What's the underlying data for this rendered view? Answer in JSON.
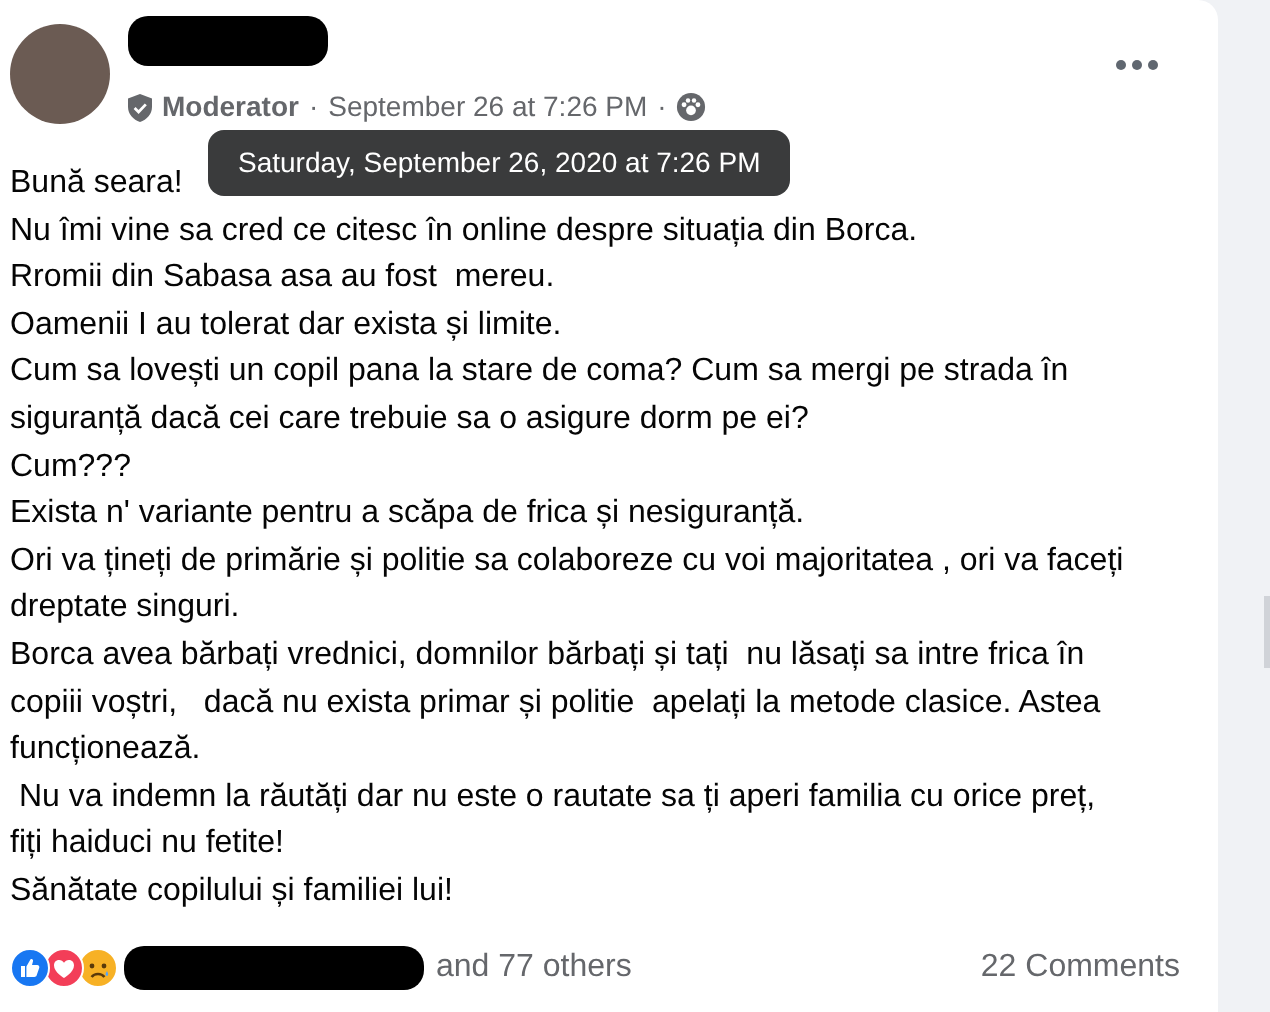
{
  "post": {
    "role": "Moderator",
    "timestamp": "September 26 at 7:26 PM",
    "separator": "·",
    "tooltip": "Saturday, September 26, 2020 at 7:26 PM",
    "paragraphs": [
      "Bună seara!",
      "Nu îmi vine sa cred ce citesc în online despre situația din Borca.",
      "Rromii din Sabasa asa au fost  mereu.",
      "Oamenii I au tolerat dar exista și limite.",
      "Cum sa lovești un copil pana la stare de coma? Cum sa mergi pe strada în siguranță dacă cei care trebuie sa o asigure dorm pe ei?",
      "Cum???",
      "Exista n' variante pentru a scăpa de frica și nesiguranță.",
      "Ori va țineți de primărie și politie sa colaboreze cu voi majoritatea , ori va faceți dreptate singuri.",
      "Borca avea bărbați vrednici, domnilor bărbați și tați  nu lăsați sa intre frica în copiii voștri,   dacă nu exista primar și politie  apelați la metode clasice. Astea funcționează.",
      " Nu va indemn la răutăți dar nu este o rautate sa ți aperi familia cu orice preț,  fiți haiduci nu fetite!",
      "Sănătate copilului și familiei lui!"
    ],
    "reactions": [
      {
        "kind": "like"
      },
      {
        "kind": "love"
      },
      {
        "kind": "sad"
      }
    ],
    "reactors_suffix": "and 77 others",
    "comments": "22 Comments"
  }
}
